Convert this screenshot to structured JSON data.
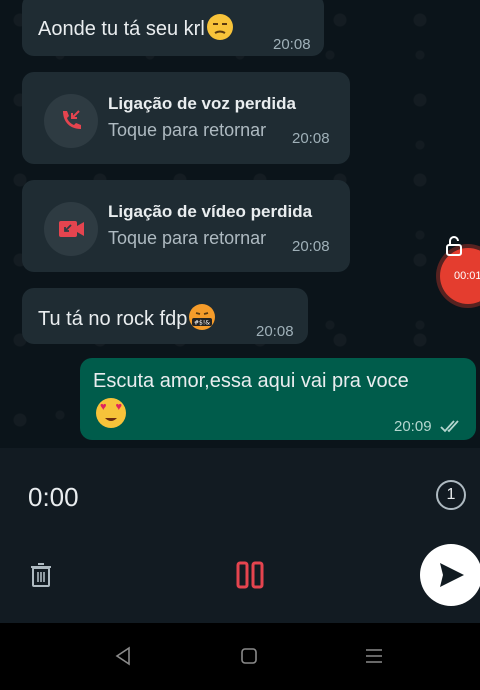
{
  "messages": [
    {
      "text": "Aonde tu tá seu krl",
      "emoji": "unamused-face",
      "time": "20:08"
    },
    {
      "call_title": "Ligação de voz perdida",
      "call_sub": "Toque para retornar",
      "icon": "missed-voice-call-icon",
      "time": "20:08"
    },
    {
      "call_title": "Ligação de vídeo perdida",
      "call_sub": "Toque para retornar",
      "icon": "missed-video-call-icon",
      "time": "20:08"
    },
    {
      "text": "Tu tá no rock fdp",
      "emoji": "face-with-symbols-on-mouth",
      "time": "20:08"
    },
    {
      "text": "Escuta amor,essa aqui vai pra voce",
      "emoji": "smiling-face-with-heart-eyes",
      "time": "20:09",
      "status": "read-double-check"
    }
  ],
  "recording_badge": {
    "time": "00:01"
  },
  "recorder": {
    "timer": "0:00",
    "view_once_label": "1"
  },
  "colors": {
    "incoming": "#1f2c33",
    "outgoing": "#005c4b",
    "accent_red": "#e5444f",
    "background": "#0b141a"
  }
}
